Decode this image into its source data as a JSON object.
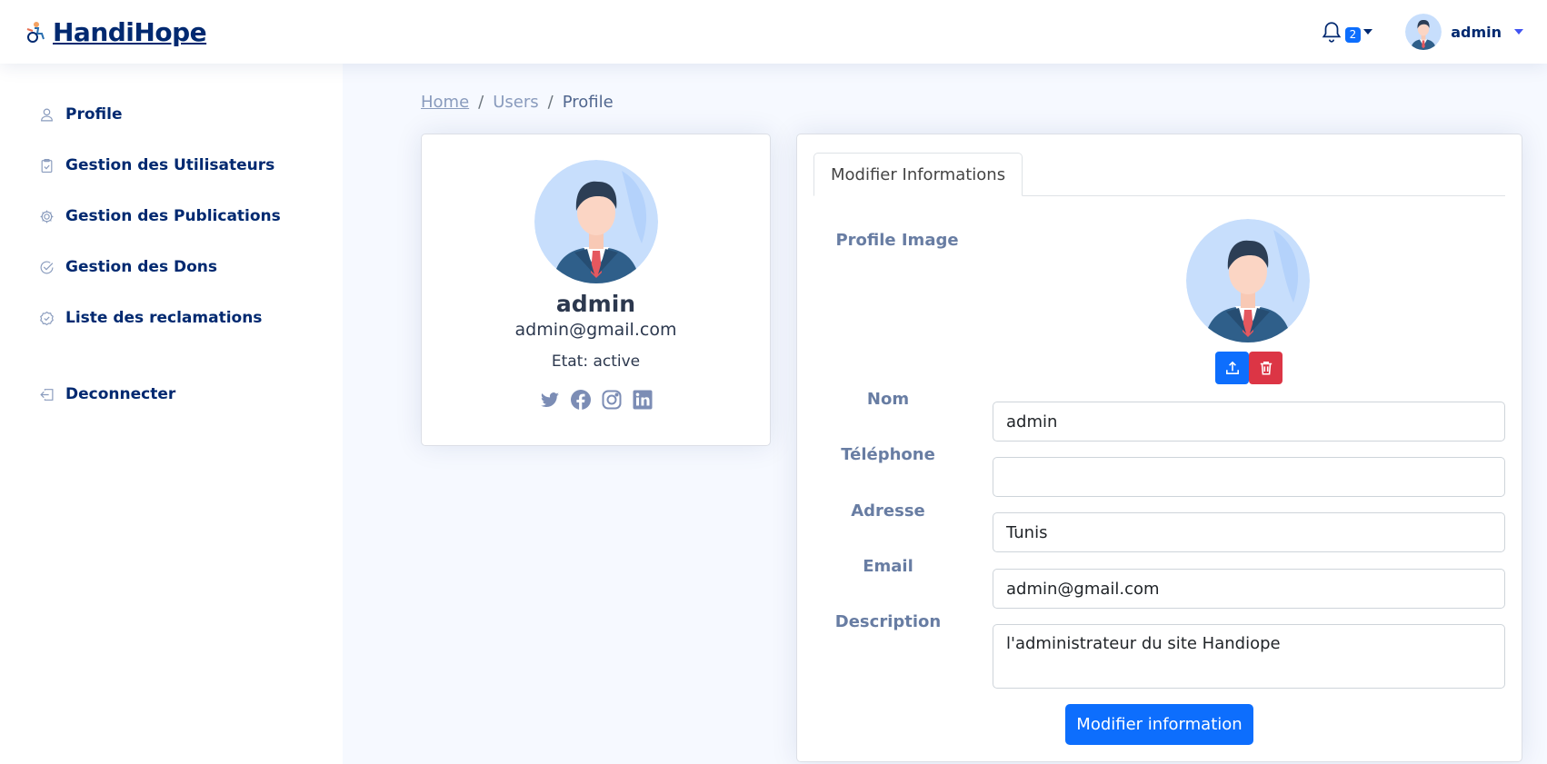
{
  "app": {
    "logo_text": "HandiHope"
  },
  "header": {
    "notifications_count": "2",
    "user_name": "admin"
  },
  "sidebar": {
    "items": [
      {
        "label": "Profile",
        "icon": "person-icon"
      },
      {
        "label": "Gestion des Utilisateurs",
        "icon": "clipboard-check-icon"
      },
      {
        "label": "Gestion des Publications",
        "icon": "gear-icon"
      },
      {
        "label": "Gestion des Dons",
        "icon": "check-circle-icon"
      },
      {
        "label": "Liste des reclamations",
        "icon": "patch-check-icon"
      }
    ],
    "logout": {
      "label": "Deconnecter",
      "icon": "box-arrow-in-left-icon"
    }
  },
  "breadcrumb": {
    "home": "Home",
    "users": "Users",
    "current": "Profile",
    "separator": "/"
  },
  "profile_card": {
    "name": "admin",
    "email": "admin@gmail.com",
    "etat": "Etat: active",
    "socials": [
      "twitter-icon",
      "facebook-icon",
      "instagram-icon",
      "linkedin-icon"
    ]
  },
  "edit_card": {
    "tab_label": "Modifier Informations",
    "profile_image_label": "Profile Image",
    "fields": {
      "nom": {
        "label": "Nom",
        "value": "admin"
      },
      "telephone": {
        "label": "Téléphone",
        "value": ""
      },
      "adresse": {
        "label": "Adresse",
        "value": "Tunis"
      },
      "email": {
        "label": "Email",
        "value": "admin@gmail.com"
      },
      "description": {
        "label": "Description",
        "value": "l'administrateur du site Handiope"
      }
    },
    "submit_label": "Modifier information"
  },
  "colors": {
    "brand": "#012970",
    "primary": "#0d6efd",
    "danger": "#dc3545",
    "label": "#687da3",
    "background": "#f6f9ff"
  }
}
